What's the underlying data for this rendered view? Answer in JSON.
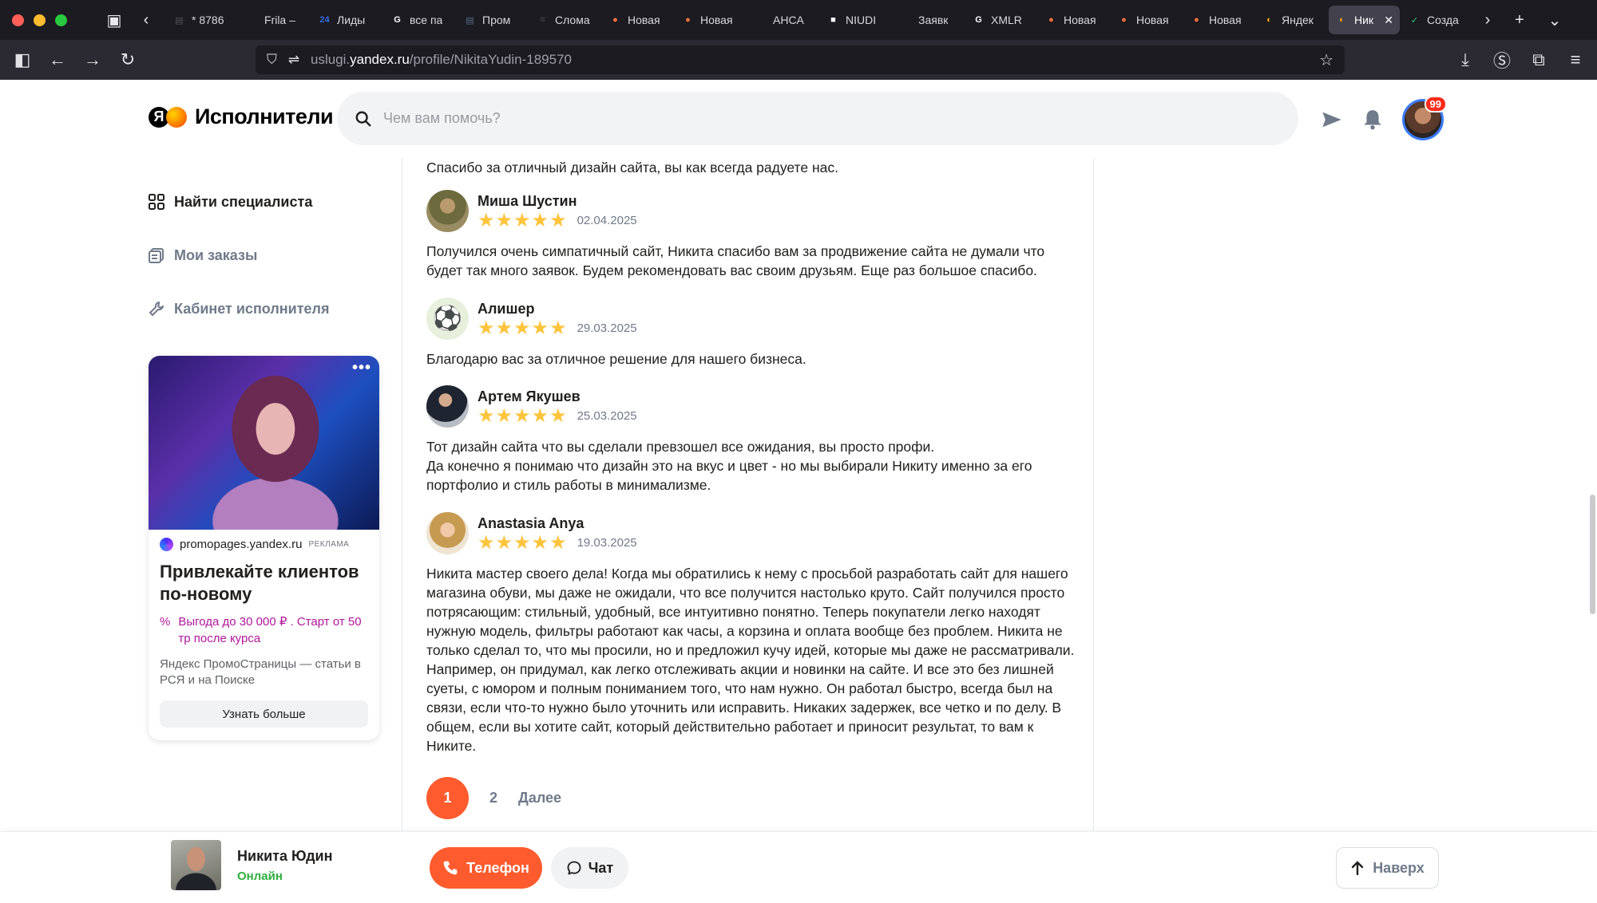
{
  "browser": {
    "tabs": [
      {
        "title": "* 8786",
        "icon": "doc",
        "color": "#555"
      },
      {
        "title": "Frila –",
        "icon": "triangle",
        "color": "#1c1b22"
      },
      {
        "title": "Лиды",
        "icon": "24",
        "color": "#2f6fe0"
      },
      {
        "title": "все па",
        "icon": "G",
        "color": "#fff"
      },
      {
        "title": "Пром",
        "icon": "doc",
        "color": "#5a6b8c"
      },
      {
        "title": "Слома",
        "icon": "bracket",
        "color": "#3c3c3c"
      },
      {
        "title": "Новая",
        "icon": "firefox",
        "color": "#ff7139"
      },
      {
        "title": "Новая",
        "icon": "firefox",
        "color": "#ff7139"
      },
      {
        "title": "AHCA",
        "icon": "A",
        "color": "#1c1b22"
      },
      {
        "title": "NIUDI",
        "icon": "square",
        "color": "#fff"
      },
      {
        "title": "Заявк",
        "icon": "T",
        "color": "#1c1b22"
      },
      {
        "title": "XMLR",
        "icon": "G",
        "color": "#fff"
      },
      {
        "title": "Новая",
        "icon": "firefox",
        "color": "#ff7139"
      },
      {
        "title": "Новая",
        "icon": "firefox",
        "color": "#ff7139"
      },
      {
        "title": "Новая",
        "icon": "firefox",
        "color": "#ff7139"
      },
      {
        "title": "Яндек",
        "icon": "yandex",
        "color": "#ffb000"
      },
      {
        "title": "Ник",
        "icon": "yandex",
        "color": "#ffb000",
        "active": true
      },
      {
        "title": "Созда",
        "icon": "v",
        "color": "#2ecc71"
      }
    ],
    "url_prefix": "uslugi.",
    "url_host": "yandex.ru",
    "url_path": "/profile/NikitaYudin-189570"
  },
  "header": {
    "logo_letter": "Я",
    "logo_text": "Исполнители",
    "search_placeholder": "Чем вам помочь?",
    "notifications_badge": "99"
  },
  "sidebar": {
    "items": [
      {
        "label": "Найти специалиста",
        "icon": "grid-icon"
      },
      {
        "label": "Мои заказы",
        "icon": "orders-icon"
      },
      {
        "label": "Кабинет исполнителя",
        "icon": "wrench-icon"
      }
    ]
  },
  "ad": {
    "domain": "promopages.yandex.ru",
    "tag": "реклама",
    "title": "Привлекайте клиентов по-новому",
    "offer": "Выгода до 30 000 ₽ . Старт от 50 тр после курса",
    "description": "Яндекс ПромоСтраницы — статьи в РСЯ и на Поиске",
    "button": "Узнать больше",
    "menu": "•••"
  },
  "reviews": {
    "top_text": "Спасибо за отличный дизайн сайта, вы как всегда радуете нас.",
    "items": [
      {
        "name": "Миша Шустин",
        "rating": 5,
        "date": "02.04.2025",
        "text": "Получился очень симпатичный сайт, Никита спасибо вам за продвижение сайта не думали что будет так много заявок. Будем рекомендовать вас своим друзьям. Еще раз большое спасибо."
      },
      {
        "name": "Алишер",
        "rating": 5,
        "date": "29.03.2025",
        "text": "Благодарю вас за отличное решение для нашего бизнеса."
      },
      {
        "name": "Артем Якушев",
        "rating": 5,
        "date": "25.03.2025",
        "text": "Тот дизайн сайта что вы сделали превзошел все ожидания, вы просто профи.\nДа конечно я понимаю что дизайн это на вкус и цвет - но мы выбирали Никиту именно за его портфолио и стиль работы в минимализме."
      },
      {
        "name": "Anastasia Anya",
        "rating": 5,
        "date": "19.03.2025",
        "text": "Никита мастер своего дела! Когда мы обратились к нему с просьбой разработать сайт для нашего магазина обуви, мы даже не ожидали, что все получится настолько круто. Сайт получился просто потрясающим: стильный, удобный, все интуитивно понятно. Теперь покупатели легко находят нужную модель, фильтры работают как часы, а корзина и оплата вообще без проблем. Никита не только сделал то, что мы просили, но и предложил кучу идей, которые мы даже не рассматривали. Например, он придумал, как легко отслеживать акции и новинки на сайте. И все это без лишней суеты, с юмором и полным пониманием того, что нам нужно. Он работал быстро, всегда был на связи, если что-то нужно было уточнить или исправить. Никаких задержек, все четко и по делу. В общем, если вы хотите сайт, который действительно работает и приносит результат, то вам к Никите."
      }
    ],
    "pagination": {
      "current": "1",
      "next_page": "2",
      "next_label": "Далее"
    }
  },
  "bottom_bar": {
    "name": "Никита Юдин",
    "status": "Онлайн",
    "phone_label": "Телефон",
    "chat_label": "Чат",
    "top_label": "Наверх"
  },
  "colors": {
    "accent": "#ff5b2e",
    "star": "#ffc43c",
    "online": "#2fae3c",
    "ad_offer": "#b1169c"
  }
}
